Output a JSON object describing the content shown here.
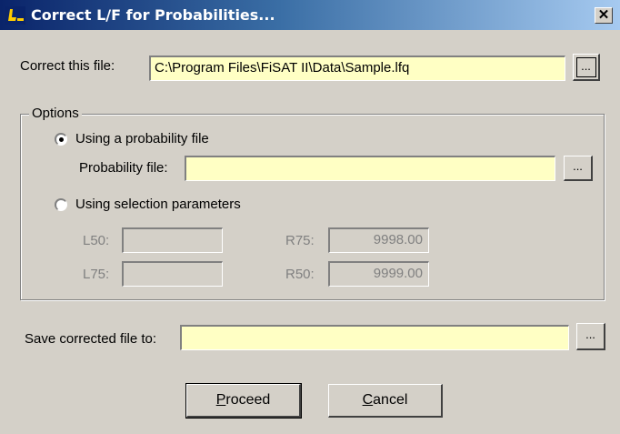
{
  "window": {
    "title": "Correct L/F for Probabilities...",
    "close_glyph": "✕"
  },
  "correct_file": {
    "label": "Correct this file:",
    "value": "C:\\Program Files\\FiSAT II\\Data\\Sample.lfq",
    "browse_label": "..."
  },
  "options": {
    "legend": "Options",
    "probability_radio": {
      "label": "Using a probability file",
      "selected": true
    },
    "probability_file": {
      "label": "Probability file:",
      "value": "",
      "browse_label": "..."
    },
    "selection_radio": {
      "label": "Using selection parameters",
      "selected": false
    },
    "params": {
      "l50": {
        "label": "L50:",
        "value": ""
      },
      "l75": {
        "label": "L75:",
        "value": ""
      },
      "r75": {
        "label": "R75:",
        "value": "9998.00"
      },
      "r50": {
        "label": "R50:",
        "value": "9999.00"
      }
    }
  },
  "save": {
    "label": "Save corrected file to:",
    "value": "",
    "browse_label": "..."
  },
  "buttons": {
    "proceed": {
      "label": "Proceed",
      "mnemonic": "P"
    },
    "cancel": {
      "label": "Cancel",
      "mnemonic": "C"
    }
  },
  "colors": {
    "title_gradient_start": "#0a246a",
    "title_gradient_end": "#a6caf0",
    "field_background": "#ffffc4",
    "dialog_background": "#d4d0c8"
  }
}
